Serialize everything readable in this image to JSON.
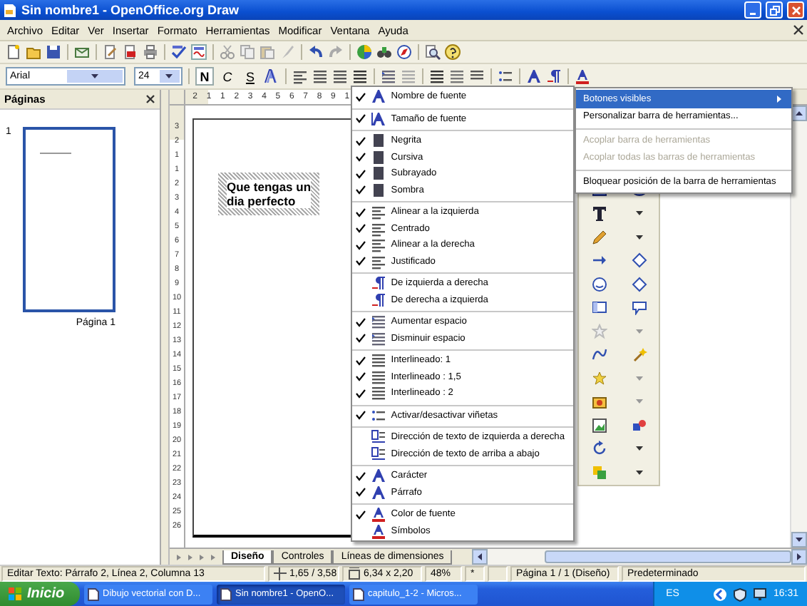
{
  "window": {
    "title": "Sin nombre1 - OpenOffice.org Draw"
  },
  "menu_bar": {
    "items": [
      "Archivo",
      "Editar",
      "Ver",
      "Insertar",
      "Formato",
      "Herramientas",
      "Modificar",
      "Ventana",
      "Ayuda"
    ]
  },
  "format_toolbar": {
    "font_name": "Arial",
    "font_size": "24",
    "buttons": [
      {
        "label": "N"
      },
      {
        "label": "C"
      },
      {
        "label": "S"
      }
    ]
  },
  "pages_panel": {
    "title": "Páginas",
    "pages": [
      {
        "number": "1",
        "label": "Página 1",
        "selected": true
      }
    ]
  },
  "rulers": {
    "horizontal": [
      "2",
      "1",
      "1",
      "2",
      "3",
      "4",
      "5",
      "6",
      "7",
      "8",
      "9",
      "1"
    ],
    "vertical": [
      "3",
      "2",
      "1",
      "1",
      "2",
      "3",
      "4",
      "5",
      "6",
      "7",
      "8",
      "9",
      "10",
      "11",
      "12",
      "13",
      "14",
      "15",
      "16",
      "17",
      "18",
      "19",
      "20",
      "21",
      "22",
      "23",
      "24",
      "25",
      "26"
    ]
  },
  "canvas": {
    "text_box": {
      "lines": [
        "Que tengas un",
        "dia perfecto"
      ]
    }
  },
  "visible_buttons_menu": {
    "groups": [
      [
        {
          "label": "Nombre de fuente",
          "checked": true
        }
      ],
      [
        {
          "label": "Tamaño de fuente",
          "checked": true
        }
      ],
      [
        {
          "label": "Negrita",
          "checked": true
        },
        {
          "label": "Cursiva",
          "checked": true
        },
        {
          "label": "Subrayado",
          "checked": true
        },
        {
          "label": "Sombra",
          "checked": true
        }
      ],
      [
        {
          "label": "Alinear a la izquierda",
          "checked": true
        },
        {
          "label": "Centrado",
          "checked": true
        },
        {
          "label": "Alinear a la derecha",
          "checked": true
        },
        {
          "label": "Justificado",
          "checked": true
        }
      ],
      [
        {
          "label": "De izquierda a derecha",
          "checked": false
        },
        {
          "label": "De derecha a izquierda",
          "checked": false
        }
      ],
      [
        {
          "label": "Aumentar espacio",
          "checked": true
        },
        {
          "label": "Disminuir espacio",
          "checked": true
        }
      ],
      [
        {
          "label": "Interlineado: 1",
          "checked": true
        },
        {
          "label": "Interlineado : 1,5",
          "checked": true
        },
        {
          "label": "Interlineado : 2",
          "checked": true
        }
      ],
      [
        {
          "label": "Activar/desactivar viñetas",
          "checked": true
        }
      ],
      [
        {
          "label": "Dirección de texto de izquierda a derecha",
          "checked": false
        },
        {
          "label": "Dirección de texto de arriba a abajo",
          "checked": false
        }
      ],
      [
        {
          "label": "Carácter",
          "checked": true
        },
        {
          "label": "Párrafo",
          "checked": true
        }
      ],
      [
        {
          "label": "Color de fuente",
          "checked": true
        },
        {
          "label": "Símbolos",
          "checked": false
        }
      ]
    ]
  },
  "toolbar_options_menu": {
    "groups": [
      [
        {
          "label": "Botones visibles",
          "selected": true,
          "disabled": false,
          "submenu": true
        },
        {
          "label": "Personalizar barra de herramientas...",
          "selected": false,
          "disabled": false,
          "submenu": false
        }
      ],
      [
        {
          "label": "Acoplar barra de herramientas",
          "selected": false,
          "disabled": true,
          "submenu": false
        },
        {
          "label": "Acoplar todas las barras de herramientas",
          "selected": false,
          "disabled": true,
          "submenu": false
        }
      ],
      [
        {
          "label": "Bloquear posición de la barra de herramientas",
          "selected": false,
          "disabled": false,
          "submenu": false
        }
      ]
    ]
  },
  "layer_tabs": [
    {
      "label": "Diseño",
      "selected": true
    },
    {
      "label": "Controles",
      "selected": false
    },
    {
      "label": "Líneas de dimensiones",
      "selected": false
    }
  ],
  "status_bar": {
    "fields": [
      "Editar Texto: Párrafo 2, Línea 2, Columna 13",
      "1,65 / 3,58",
      "6,34 x 2,20",
      "48%",
      "*",
      "Página 1 / 1 (Diseño)",
      "Predeterminado"
    ]
  },
  "taskbar": {
    "start": "Inicio",
    "tasks": [
      {
        "label": "Dibujo vectorial con D...",
        "selected": false
      },
      {
        "label": "Sin nombre1 - OpenO...",
        "selected": true
      },
      {
        "label": "capitulo_1-2 - Micros...",
        "selected": false
      }
    ],
    "language": "ES",
    "clock": "16:31"
  }
}
